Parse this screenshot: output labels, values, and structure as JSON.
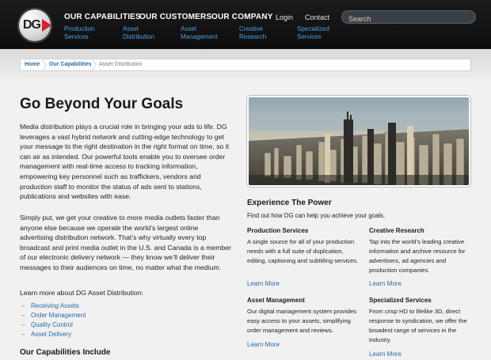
{
  "brand": {
    "logo_text": "DG"
  },
  "nav": {
    "main": [
      "OUR CAPABILITIES",
      "OUR CUSTOMERS",
      "OUR COMPANY"
    ],
    "utility": [
      "Login",
      "Contact"
    ],
    "search_placeholder": "Search",
    "sub": [
      [
        "Production",
        "Services"
      ],
      [
        "Asset",
        "Distribution"
      ],
      [
        "Asset",
        "Management"
      ],
      [
        "Creative",
        "Research"
      ],
      [
        "Specialized",
        "Services"
      ]
    ]
  },
  "breadcrumb": [
    "Home",
    "Our Capabilities",
    "Asset Distribution"
  ],
  "page": {
    "title": "Go Beyond Your Goals",
    "para1": "Media distribution plays a crucial role in bringing your ads to life. DG leverages a vast hybrid network and cutting-edge technology to get your message to the right destination in the right format on time, so it can air as intended. Our powerful tools enable you to oversee order management with real-time access to tracking information, empowering key personnel such as traffickers, vendors and production staff to monitor the status of ads sent to stations, publications and websites with ease.",
    "para2": "Simply put, we get your creative to more media outlets faster than anyone else because we operate the world’s largest online advertising distribution network. That’s why virtually every top broadcast and print media outlet in the U.S. and Canada is a member of our electronic delivery network — they know we’ll deliver their messages to their audiences on time, no matter what the medium.",
    "learn_label": "Learn more about DG Asset Distribution:",
    "learn_links": [
      "Receiving Assets",
      "Order Management",
      "Quality Control",
      "Asset Delivery"
    ],
    "caps_heading": "Our Capabilities Include"
  },
  "experience": {
    "title": "Experience The Power",
    "subtitle": "Find out how DG can help you achieve your goals.",
    "learn_more": "Learn More",
    "services": [
      {
        "title": "Production Services",
        "desc": "A single source for all of your production needs with a full suite of duplication, editing, captioning and subtitling services."
      },
      {
        "title": "Creative Research",
        "desc": "Tap into the world’s leading creative information and archive resource for advertisers, ad agencies and production companies."
      },
      {
        "title": "Asset Management",
        "desc": "Our digital management system provides easy access to your assets, simplifying order management and reviews."
      },
      {
        "title": "Specialized Services",
        "desc": "From crisp HD to lifelike 3D, direct response to syndication, we offer the broadest range of services in the industry."
      }
    ]
  },
  "colors": {
    "accent_red": "#d6202b",
    "link_blue": "#2b6aa8",
    "nav_sub_blue": "#4aa0e0",
    "header_bg": "#111111"
  }
}
